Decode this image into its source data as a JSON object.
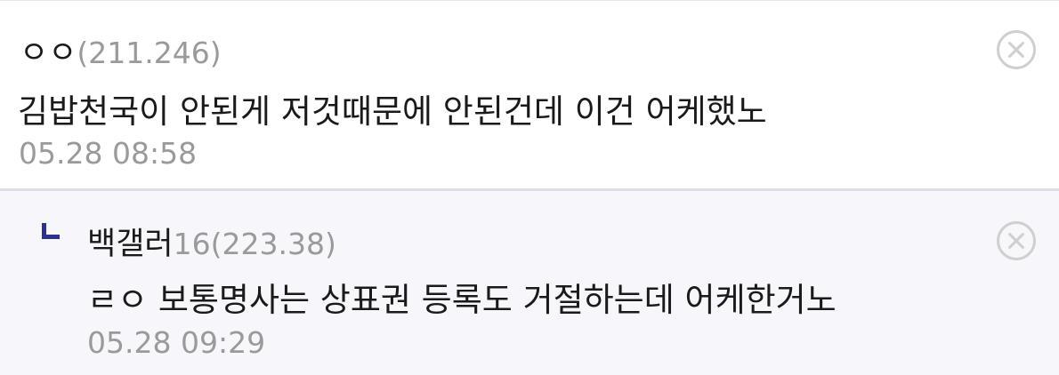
{
  "comments": [
    {
      "nickname": "ㅇㅇ",
      "ip": "(211.246)",
      "text": "김밥천국이 안된게 저것때문에 안된건데 이건 어케했노",
      "date": "05.28 08:58",
      "delete_icon": "close-circle-icon"
    }
  ],
  "replies": [
    {
      "nickname": "백갤러",
      "level": "16",
      "ip": "(223.38)",
      "text": "ㄹㅇ 보통명사는 상표권 등록도 거절하는데 어케한거노",
      "date": "05.28 09:29",
      "reply_icon": "reply-arrow-icon",
      "delete_icon": "close-circle-icon"
    }
  ]
}
